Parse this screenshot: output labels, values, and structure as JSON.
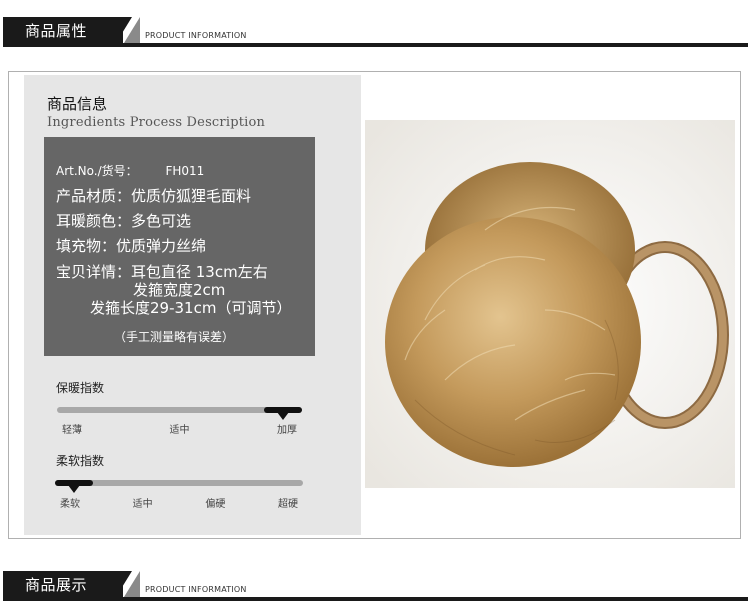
{
  "header_top": {
    "title": "商品属性",
    "subtitle": "PRODUCT INFORMATION"
  },
  "panel": {
    "title": "商品信息",
    "subtitle": "Ingredients  Process Description"
  },
  "specs": {
    "art_label": "Art.No./货号：",
    "art_code": "FH011",
    "material": "产品材质：优质仿狐狸毛面料",
    "color": "耳暖颜色：多色可选",
    "filling": "填充物：优质弹力丝绵",
    "details_1": "宝贝详情：耳包直径 13cm左右",
    "details_2": "发箍宽度2cm",
    "details_3": "发箍长度29-31cm（可调节）",
    "note": "（手工测量略有误差）"
  },
  "warmth_index": {
    "title": "保暖指数",
    "labels": [
      "轻薄",
      "适中",
      "加厚"
    ],
    "level": 1.0
  },
  "softness_index": {
    "title": "柔软指数",
    "labels": [
      "柔软",
      "适中",
      "偏硬",
      "超硬"
    ],
    "level": 0.0
  },
  "product_image": {
    "subject": "fur earmuffs",
    "fur_color": "#c49a5c",
    "band_color": "#b99466"
  },
  "header_bottom": {
    "title": "商品展示",
    "subtitle": "PRODUCT INFORMATION"
  }
}
